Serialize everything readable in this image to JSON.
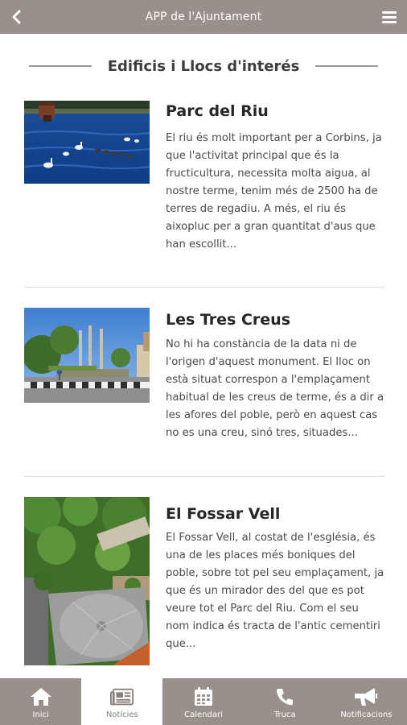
{
  "header": {
    "title": "APP de l'Ajuntament",
    "back_icon": "chevron-left-icon",
    "menu_icon": "hamburger-menu-icon"
  },
  "section": {
    "title": "Edificis i Llocs d'interés"
  },
  "items": [
    {
      "title": "Parc del Riu",
      "description": "El riu és molt important per a Corbins, ja que l'activitat principal que és la fructicultura, necessita molta aigua,  al nostre terme, tenim més de 2500 ha de terres de regadiu. A més, el riu és aixopluc per a gran quantitat d'aus que han escollit..."
    },
    {
      "title": "Les Tres Creus",
      "description": "No hi ha constància de la data ni de l'origen d'aquest monument. El lloc on està situat correspon a l'emplaçament habitual de les creus de terme, és a dir a les afores del poble, però en aquest cas no es una creu, sinó tres, situades..."
    },
    {
      "title": "El Fossar Vell",
      "description": "El Fossar Vell, al costat de l'església, és una de les places més boniques del poble, sobre tot pel seu emplaçament, ja que és un mirador des del que es pot veure tot el Parc del Riu. Com el seu nom indica és tracta de l'antic cementiri que..."
    }
  ],
  "tabs": [
    {
      "label": "Inici",
      "icon": "home-icon",
      "active": false
    },
    {
      "label": "Notícies",
      "icon": "newspaper-icon",
      "active": true
    },
    {
      "label": "Calendari",
      "icon": "calendar-icon",
      "active": false
    },
    {
      "label": "Truca",
      "icon": "phone-icon",
      "active": false
    },
    {
      "label": "Notificacions",
      "icon": "megaphone-icon",
      "active": false
    }
  ],
  "colors": {
    "bar": "#9a908b",
    "active_tab_bg": "#ffffff",
    "active_tab_fg": "#8a807b"
  }
}
